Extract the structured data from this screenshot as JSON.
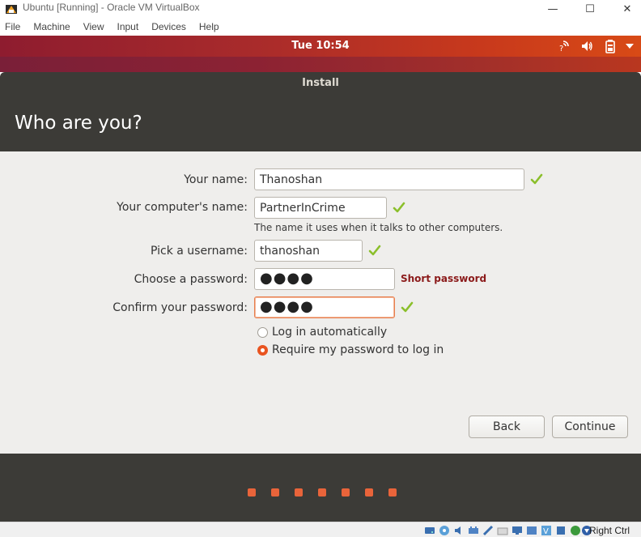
{
  "window": {
    "title": "Ubuntu [Running] - Oracle VM VirtualBox",
    "minimize_glyph": "—",
    "maximize_glyph": "☐",
    "close_glyph": "✕"
  },
  "menubar": [
    "File",
    "Machine",
    "View",
    "Input",
    "Devices",
    "Help"
  ],
  "ubuntu_panel": {
    "clock": "Tue 10:54",
    "indicators": [
      "network-icon",
      "volume-icon",
      "battery-icon",
      "system-menu-arrow-icon"
    ]
  },
  "installer": {
    "window_title": "Install",
    "heading": "Who are you?",
    "fields": {
      "your_name": {
        "label": "Your name:",
        "value": "Thanoshan"
      },
      "computer_name": {
        "label": "Your computer's name:",
        "value": "PartnerInCrime",
        "hint": "The name it uses when it talks to other computers."
      },
      "username": {
        "label": "Pick a username:",
        "value": "thanoshan"
      },
      "password": {
        "label": "Choose a password:",
        "value": "●●●●",
        "strength": "Short password"
      },
      "confirm_password": {
        "label": "Confirm your password:",
        "value": "●●●●"
      }
    },
    "login_options": [
      {
        "label": "Log in automatically",
        "selected": false
      },
      {
        "label": "Require my password to log in",
        "selected": true
      }
    ],
    "buttons": {
      "back": "Back",
      "continue": "Continue"
    },
    "progress_steps": 7
  },
  "status_bar": {
    "host_key": "Right Ctrl"
  },
  "colors": {
    "accent": "#e95420",
    "check_green": "#8bbf2b",
    "dark_header": "#3c3b37",
    "warning_text": "#8b1a1a"
  }
}
